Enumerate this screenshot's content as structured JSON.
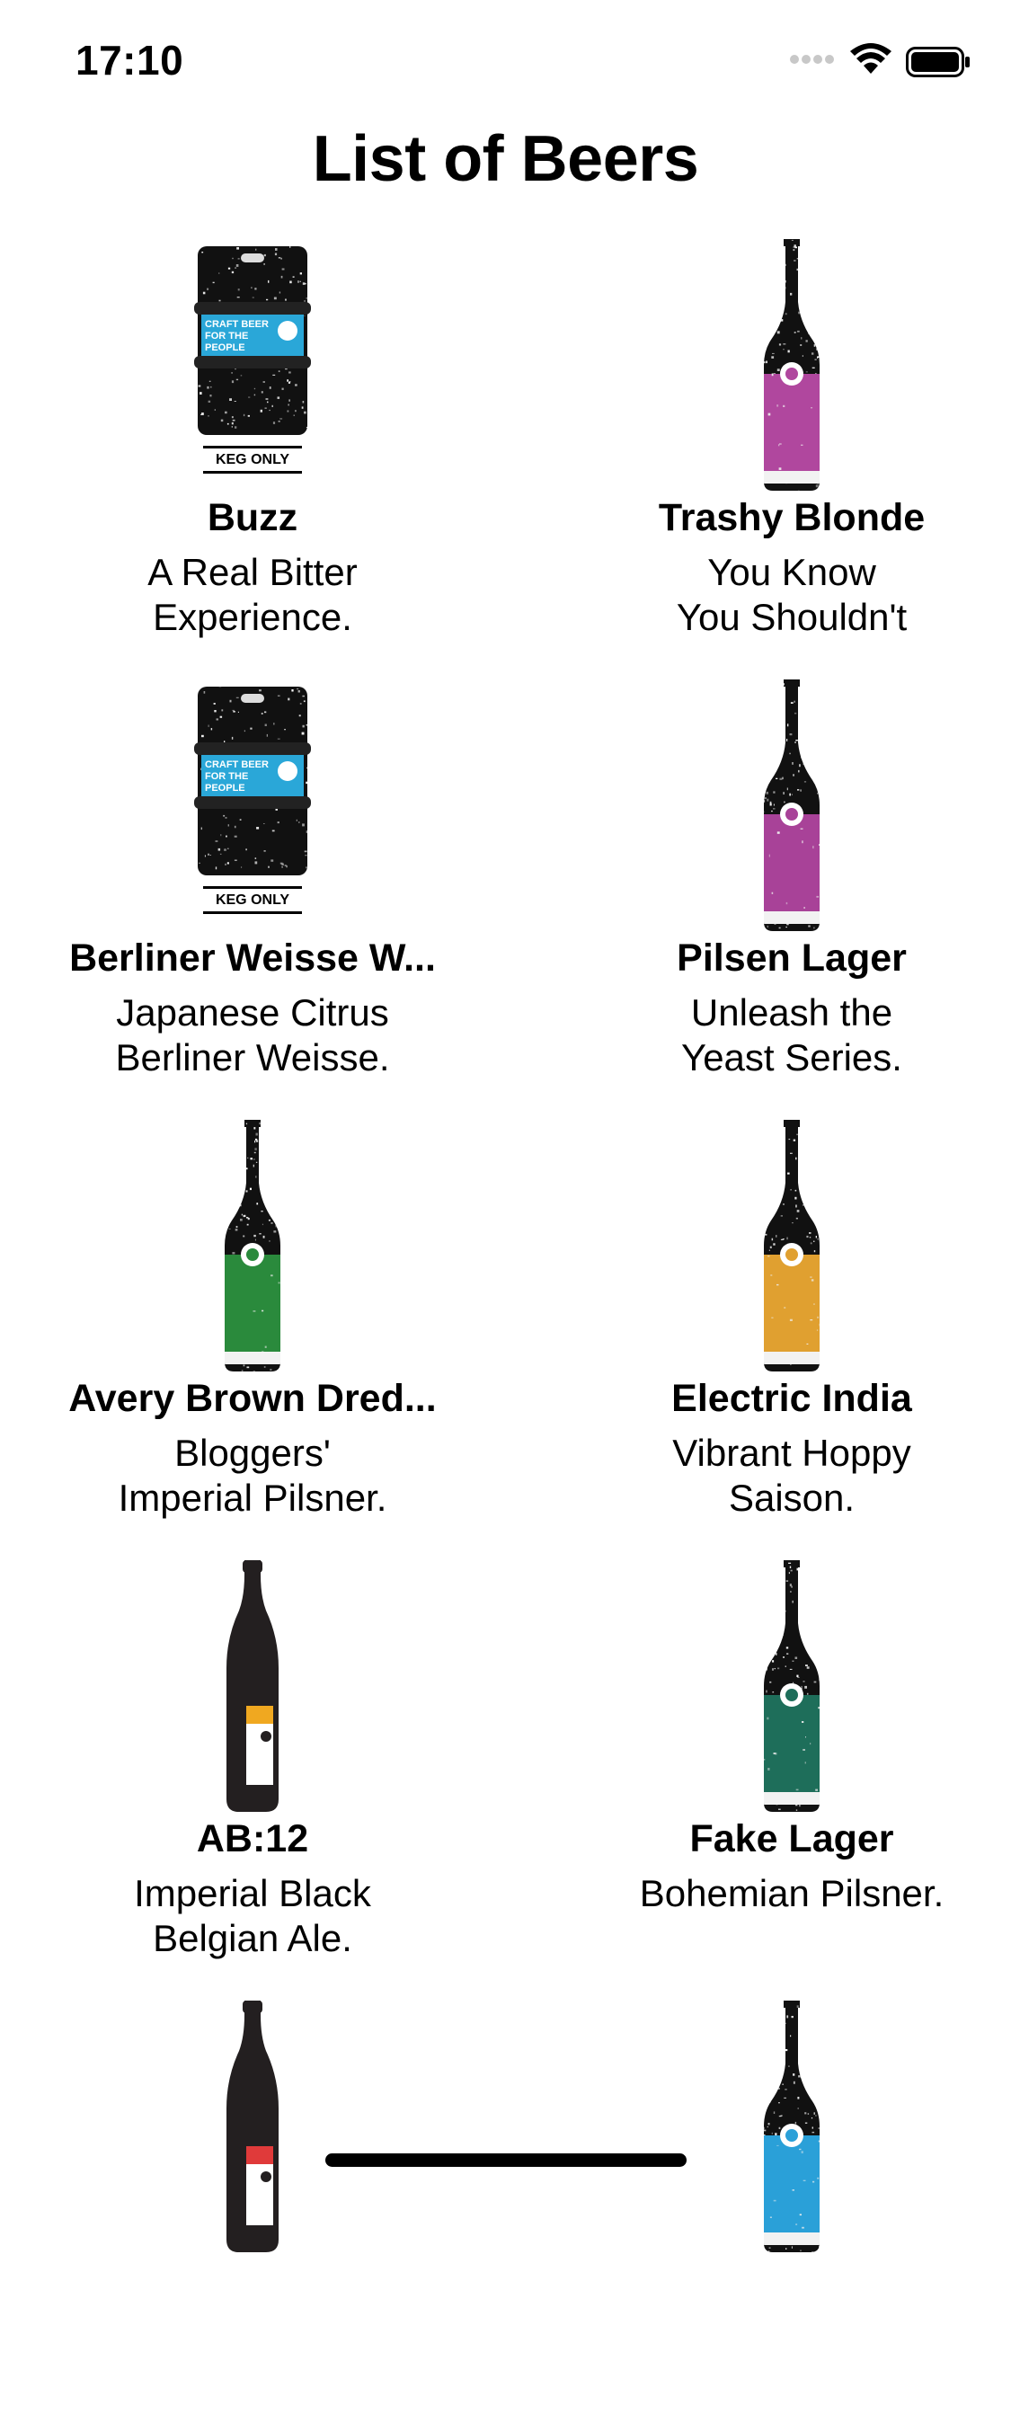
{
  "status_bar": {
    "time": "17:10",
    "icons": [
      "signal-icon",
      "wifi-icon",
      "battery-icon"
    ]
  },
  "page_title": "List of Beers",
  "beers": [
    {
      "name": "Buzz",
      "tagline": "A Real Bitter\nExperience.",
      "image": "keg",
      "label_color": "#2aa7d8",
      "keg_label": "KEG ONLY",
      "keg_text": "CRAFT BEER FOR THE PEOPLE"
    },
    {
      "name": "Trashy Blonde",
      "tagline": "You Know\nYou Shouldn't",
      "image": "bottle",
      "label_color": "#b0479e"
    },
    {
      "name": "Berliner Weisse W...",
      "tagline": "Japanese Citrus\nBerliner Weisse.",
      "image": "keg",
      "label_color": "#2aa7d8",
      "keg_label": "KEG ONLY",
      "keg_text": "CRAFT BEER FOR THE PEOPLE"
    },
    {
      "name": "Pilsen Lager",
      "tagline": "Unleash the\nYeast Series.",
      "image": "bottle",
      "label_color": "#a84298"
    },
    {
      "name": "Avery Brown Dred...",
      "tagline": "Bloggers'\nImperial Pilsner.",
      "image": "bottle",
      "label_color": "#2a8a3c"
    },
    {
      "name": "Electric India",
      "tagline": "Vibrant Hoppy\nSaison.",
      "image": "bottle",
      "label_color": "#e0a030"
    },
    {
      "name": "AB:12",
      "tagline": "Imperial Black\nBelgian Ale.",
      "image": "tall-bottle",
      "label_color": "#f0a820"
    },
    {
      "name": "Fake Lager",
      "tagline": "Bohemian Pilsner.",
      "image": "bottle",
      "label_color": "#1e6e5a"
    },
    {
      "name": "",
      "tagline": "",
      "image": "tall-bottle",
      "label_color": "#e03a3a"
    },
    {
      "name": "",
      "tagline": "",
      "image": "bottle",
      "label_color": "#2aa0d8"
    }
  ]
}
